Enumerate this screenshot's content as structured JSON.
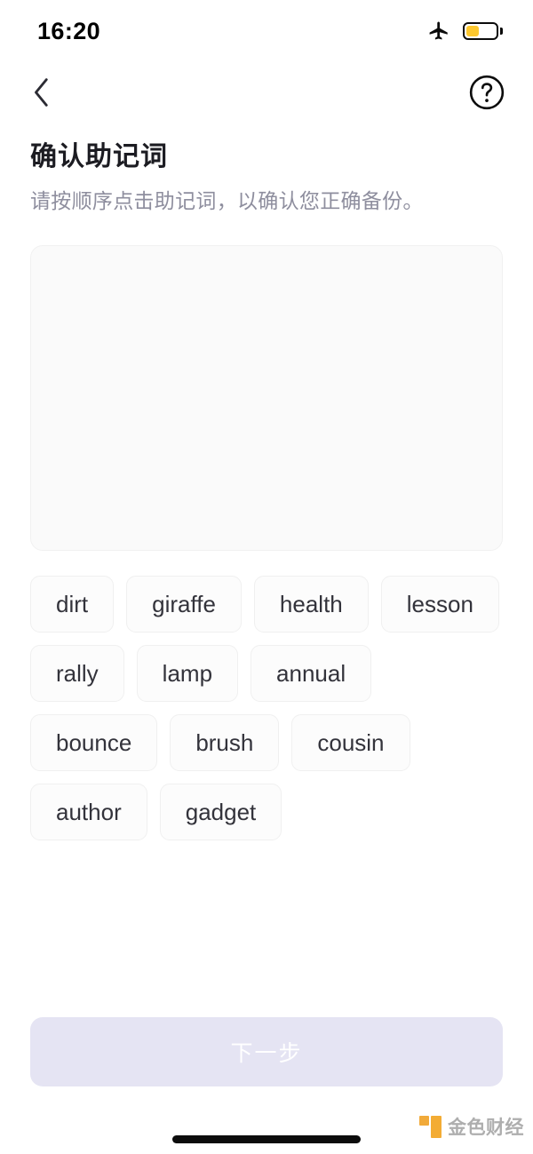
{
  "status_bar": {
    "time": "16:20",
    "airplane_icon": "airplane-mode-icon",
    "battery_icon": "battery-low-power-icon",
    "battery_level_percent": 45,
    "battery_color": "#FDC82F"
  },
  "nav": {
    "back_icon": "chevron-left-icon",
    "help_icon": "question-mark-circle-icon"
  },
  "header": {
    "title": "确认助记词",
    "subtitle": "请按顺序点击助记词，以确认您正确备份。"
  },
  "answer_area": {
    "selected_words": [],
    "background_color": "#FAFAFA"
  },
  "word_pool": {
    "words": [
      "dirt",
      "giraffe",
      "health",
      "lesson",
      "rally",
      "lamp",
      "annual",
      "bounce",
      "brush",
      "cousin",
      "author",
      "gadget"
    ]
  },
  "footer": {
    "next_label": "下一步",
    "next_disabled": true,
    "next_background_color": "#E5E4F3",
    "next_text_color": "#FFFFFF"
  },
  "watermark": {
    "text": "金色财经",
    "logo_color": "#F3A623"
  }
}
